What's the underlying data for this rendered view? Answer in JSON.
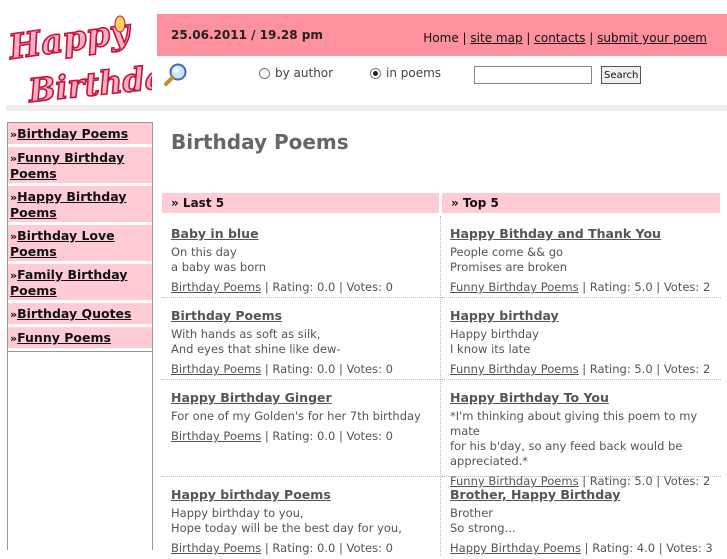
{
  "header": {
    "logo_text_1": "Happy",
    "logo_text_2": "Birthday",
    "datetime": "25.06.2011 / 19.28 pm",
    "nav": [
      {
        "label": "Home"
      },
      {
        "label": "site map"
      },
      {
        "label": "contacts"
      },
      {
        "label": "submit your poem"
      }
    ],
    "nav_sep": "|"
  },
  "search": {
    "icon": "magnifier-icon",
    "radio_author": "by author",
    "radio_poems": "in poems",
    "selected": "in poems",
    "input_value": "",
    "button": "Search"
  },
  "sidebar": {
    "arrow": "»",
    "items": [
      {
        "label": "Birthday Poems"
      },
      {
        "label": "Funny Birthday Poems"
      },
      {
        "label": "Happy Birthday Poems"
      },
      {
        "label": "Birthday Love Poems"
      },
      {
        "label": "Family Birthday Poems"
      },
      {
        "label": "Birthday Quotes"
      },
      {
        "label": "Funny Poems"
      }
    ]
  },
  "main": {
    "title": "Birthday Poems",
    "last_head": "»  Last 5",
    "top_head": "»  Top 5",
    "last": [
      {
        "title": "Baby in blue",
        "excerpt": [
          "On this day",
          "a baby was born"
        ],
        "category": "Birthday Poems",
        "meta": " | Rating: 0.0 | Votes: 0"
      },
      {
        "title": "Birthday Poems",
        "excerpt": [
          "With hands as soft as silk,",
          "And eyes that shine like dew-"
        ],
        "category": "Birthday Poems",
        "meta": " | Rating: 0.0 | Votes: 0"
      },
      {
        "title": "Happy Birthday Ginger",
        "excerpt": [
          "For one of my Golden's for her 7th birthday"
        ],
        "category": "Birthday Poems",
        "meta": " | Rating: 0.0 | Votes: 0"
      },
      {
        "title": "Happy birthday Poems",
        "excerpt": [
          "Happy birthday to you,",
          "Hope today will be the best day for you,"
        ],
        "category": "Birthday Poems",
        "meta": " | Rating: 0.0 | Votes: 0"
      }
    ],
    "top": [
      {
        "title": "Happy Bithday and Thank You",
        "excerpt": [
          "People come && go",
          "Promises are broken"
        ],
        "category": "Funny Birthday Poems",
        "meta": " | Rating: 5.0 | Votes: 2"
      },
      {
        "title": "Happy birthday",
        "excerpt": [
          "Happy birthday",
          "I know its late"
        ],
        "category": "Funny Birthday Poems",
        "meta": " | Rating: 5.0 | Votes: 2"
      },
      {
        "title": "Happy Birthday To You",
        "excerpt": [
          "*I'm thinking about giving this poem to my mate",
          "for his b'day, so any feed back would be",
          "appreciated.*"
        ],
        "category": "Funny Birthday Poems",
        "meta": " | Rating: 5.0 | Votes: 2"
      },
      {
        "title": "Brother, Happy Birthday",
        "excerpt": [
          "Brother",
          "So strong..."
        ],
        "category": "Happy Birthday Poems",
        "meta": " | Rating: 4.0 | Votes: 3"
      }
    ]
  },
  "colors": {
    "topbar": "#ff909e",
    "pink_light": "#ffccd6",
    "logo_fill": "#f7b0c0",
    "logo_stroke": "#c8103c"
  }
}
